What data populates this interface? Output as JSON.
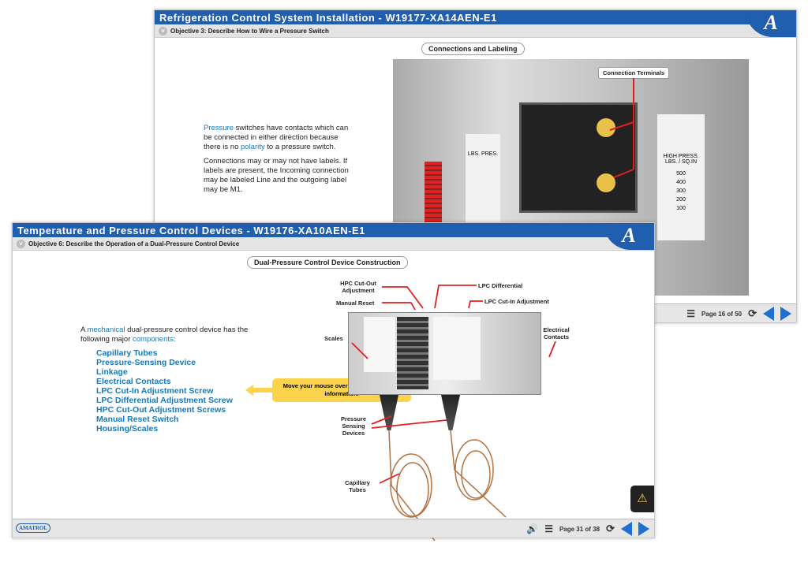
{
  "back": {
    "title": "Refrigeration Control System Installation - W19177-XA14AEN-E1",
    "objective": "Objective 3: Describe How to Wire a Pressure Switch",
    "section": "Connections and Labeling",
    "p1": [
      {
        "t": "Pressure",
        "hl": true
      },
      {
        "t": " switches have contacts which can be connected in either direction because there is no "
      },
      {
        "t": "polarity",
        "hl": true
      },
      {
        "t": " to a pressure switch."
      }
    ],
    "p2": "Connections may or may not have labels. If labels are present, the Incoming connection may be labeled Line and the outgoing label may be M1.",
    "callout": "Connection Terminals",
    "scale_left": "LBS. PRES.",
    "scale_right": "HIGH PRESS. LBS. / SQ.IN",
    "scale_vals": [
      "500",
      "400",
      "300",
      "200",
      "100"
    ],
    "page": "Page 16 of 50"
  },
  "front": {
    "title": "Temperature and Pressure Control Devices - W19176-XA10AEN-E1",
    "objective": "Objective 6: Describe the Operation of a Dual-Pressure Control Device",
    "section": "Dual-Pressure Control Device Construction",
    "intro": [
      {
        "t": "A "
      },
      {
        "t": "mechanical",
        "hl": true
      },
      {
        "t": " dual-pressure control device has the following major "
      },
      {
        "t": "components",
        "hl": true
      },
      {
        "t": ":"
      }
    ],
    "links": [
      "Capillary Tubes",
      "Pressure-Sensing Device",
      "Linkage",
      "Electrical Contacts",
      "LPC Cut-In Adjustment Screw",
      "LPC Differential Adjustment Screw",
      "HPC Cut-Out Adjustment Screws",
      "Manual Reset Switch",
      "Housing/Scales"
    ],
    "tooltip": "Move your mouse over each link for more information.",
    "labels": {
      "hpc": "HPC Cut-Out Adjustment",
      "lpc_diff": "LPC Differential",
      "reset": "Manual Reset",
      "lpc_in": "LPC Cut-In Adjustment",
      "scales": "Scales",
      "contacts": "Electrical Contacts",
      "sensing": "Pressure Sensing Devices",
      "capillary": "Capillary Tubes"
    },
    "page": "Page 31 of 38",
    "brand": "AMATROL"
  },
  "colors": {
    "title_bar": "#1f5fae",
    "link": "#1a78b8",
    "callout": "#fcd34d",
    "pointer": "#e02020"
  }
}
